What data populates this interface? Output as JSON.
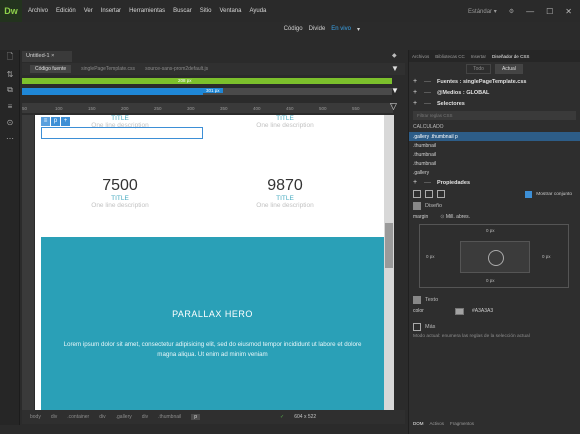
{
  "app": {
    "logo": "Dw",
    "menu": [
      "Archivo",
      "Edición",
      "Ver",
      "Insertar",
      "Herramientas",
      "Buscar",
      "Sitio",
      "Ventana",
      "Ayuda"
    ],
    "workspace": "Estándar",
    "workspace_caret": "▾",
    "sync_icon": "⚙",
    "window_min": "—",
    "window_max": "☐",
    "window_close": "✕"
  },
  "view": {
    "code": "Código",
    "split": "Divide",
    "live": "En vivo",
    "caret": "▾"
  },
  "left_tools": [
    "🗋",
    "⇅",
    "⧉",
    "≡",
    "⊙",
    "⋯"
  ],
  "document": {
    "tab": "Untitled-1",
    "tab_close": "×",
    "source_tab": "Código fuente",
    "related_files": [
      "singlePageTemplate.css",
      "source-sans-prom2default.js"
    ],
    "filter_icon": "▼"
  },
  "media_queries": {
    "green_label": "208 px",
    "blue_label": "301 px",
    "blue_fill_fraction": 0.49,
    "arrow": "▼"
  },
  "ruler": [
    "50",
    "100",
    "150",
    "200",
    "250",
    "300",
    "350",
    "400",
    "450",
    "500",
    "550"
  ],
  "design": {
    "selection_tag": "p",
    "selection_icons": [
      "≡",
      "+"
    ],
    "top_titles": [
      "TITLE",
      "TITLE"
    ],
    "top_descriptions": [
      "One line description",
      "One line description"
    ],
    "stats": [
      {
        "number": "7500",
        "title": "TITLE",
        "description": "One line description"
      },
      {
        "number": "9870",
        "title": "TITLE",
        "description": "One line description"
      }
    ],
    "hero": {
      "title": "PARALLAX HERO",
      "text": "Lorem ipsum dolor sit amet, consectetur adipisicing elit, sed do eiusmod tempor incididunt ut labore et dolore magna aliqua. Ut enim ad minim veniam",
      "color": "#2aa0b7"
    }
  },
  "statusbar": {
    "path": [
      "body",
      "div",
      ".container",
      "div",
      ".gallery",
      "div",
      ".thumbnail"
    ],
    "current": "p",
    "ok_icon": "✓",
    "size": "604 x 522"
  },
  "css_designer": {
    "tabs": [
      "Archivos",
      "Bibliotecas CC",
      "Insertar",
      "Diseñador de CSS"
    ],
    "active_tab": "Diseñador de CSS",
    "sub_tabs": [
      "Todo",
      "Actual"
    ],
    "sources": "Fuentes : singlePageTemplate.css",
    "media": "@Medios : GLOBAL",
    "selectors": "Selectores",
    "filter_placeholder": "Filtrar reglas CSS",
    "computed": "CALCULADO",
    "selector_items": [
      ".gallery .thumbnail p",
      ".thumbnail",
      ".thumbnail",
      ".thumbnail",
      ".gallery"
    ],
    "properties": "Propiedades",
    "show_set": "Mostrar conjunto",
    "layout_section": "Diseño",
    "margin_label": "margin",
    "margin_link": "Mill. abres.",
    "margin_values": {
      "top": "0 px",
      "left": "0 px",
      "right": "0 px",
      "bottom": "0 px"
    },
    "text_section": "Texto",
    "color_label": "color",
    "color_value": "#A3A3A3",
    "more_section": "Más",
    "more_note": "Modo actual: enumera las reglas de la selección actual",
    "bottom_tabs": [
      "DOM",
      "Activos",
      "Fragmentos"
    ],
    "accent": "#3d8fd6"
  }
}
